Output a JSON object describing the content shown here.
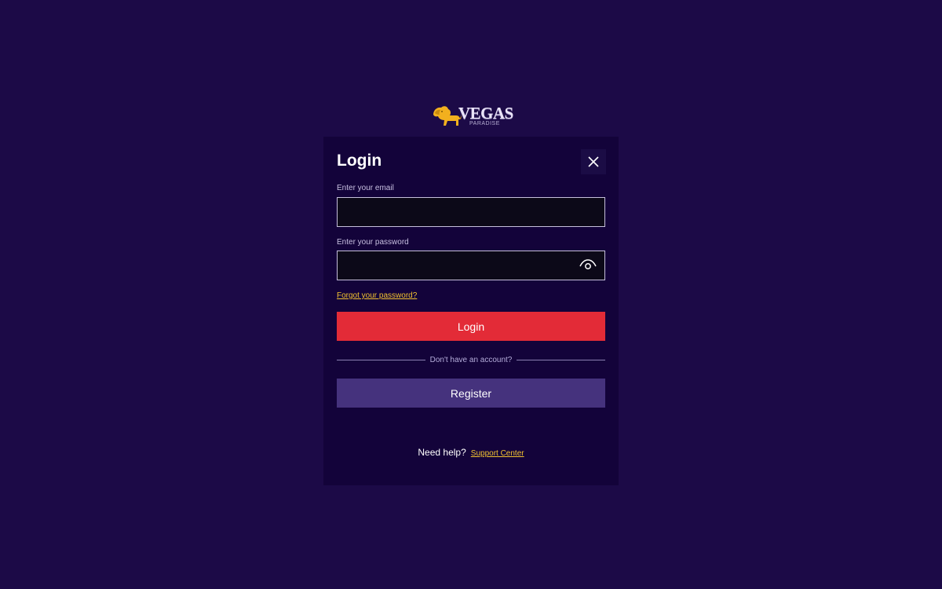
{
  "logo": {
    "brand": "VEGAS",
    "sub": "PARADISE",
    "icon": "lion-icon",
    "color": "#f2b01e"
  },
  "modal": {
    "title": "Login",
    "close_icon": "close-icon"
  },
  "email": {
    "label": "Enter your email",
    "value": "",
    "placeholder": ""
  },
  "password": {
    "label": "Enter your password",
    "value": "",
    "placeholder": "",
    "toggle_icon": "eye-icon"
  },
  "forgot_label": "Forgot your password?",
  "login_label": "Login",
  "divider_text": "Don't have an account?",
  "register_label": "Register",
  "help": {
    "text": "Need help?",
    "link": "Support Center"
  },
  "colors": {
    "background": "#1c0a47",
    "panel": "#13033a",
    "accent_red": "#e32b37",
    "accent_purple": "#45327d",
    "link_yellow": "#f2c230"
  }
}
